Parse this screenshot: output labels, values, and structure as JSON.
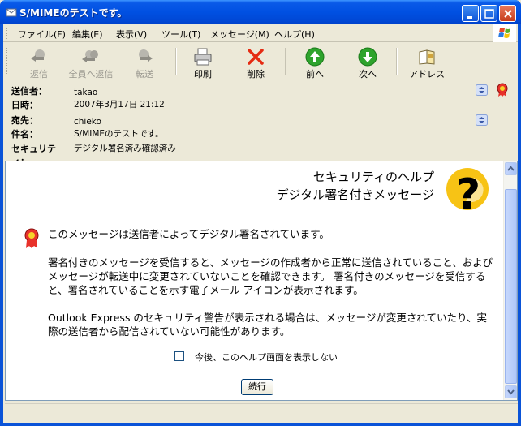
{
  "window": {
    "title": "S/MIMEのテストです。"
  },
  "menu": [
    {
      "label": "ファイル(F)"
    },
    {
      "label": "編集(E)"
    },
    {
      "label": "表示(V)"
    },
    {
      "label": "ツール(T)"
    },
    {
      "label": "メッセージ(M)"
    },
    {
      "label": "ヘルプ(H)"
    }
  ],
  "toolbar": {
    "reply": "返信",
    "reply_all": "全員へ返信",
    "forward": "転送",
    "print": "印刷",
    "delete": "削除",
    "previous": "前へ",
    "next": "次へ",
    "address": "アドレス"
  },
  "header": {
    "from_label": "送信者：",
    "from_value": "takao",
    "date_label": "日時：",
    "date_value": "2007年3月17日 21:12",
    "to_label": "宛先：",
    "to_value": "chieko",
    "subject_label": "件名：",
    "subject_value": "S/MIMEのテストです。",
    "security_label": "セキュリティ：",
    "security_value": "デジタル署名済み確認済み"
  },
  "help": {
    "title_line1": "セキュリティのヘルプ",
    "title_line2": "デジタル署名付きメッセージ",
    "para1": "このメッセージは送信者によってデジタル署名されています。",
    "para2": "署名付きのメッセージを受信すると、メッセージの作成者から正常に送信されていること、およびメッセージが転送中に変更されていないことを確認できます。 署名付きのメッセージを受信すると、署名されていることを示す電子メール アイコンが表示されます。",
    "para3": "Outlook Express のセキュリティ警告が表示される場合は、メッセージが変更されていたり、実際の送信者から配信されていない可能性があります。",
    "checkbox_label": "今後、このヘルプ画面を表示しない",
    "continue_button": "続行"
  },
  "colors": {
    "titlebar": "#0050e2",
    "window_bg": "#ece9d8",
    "scrollbar": "#c5d6fc"
  }
}
